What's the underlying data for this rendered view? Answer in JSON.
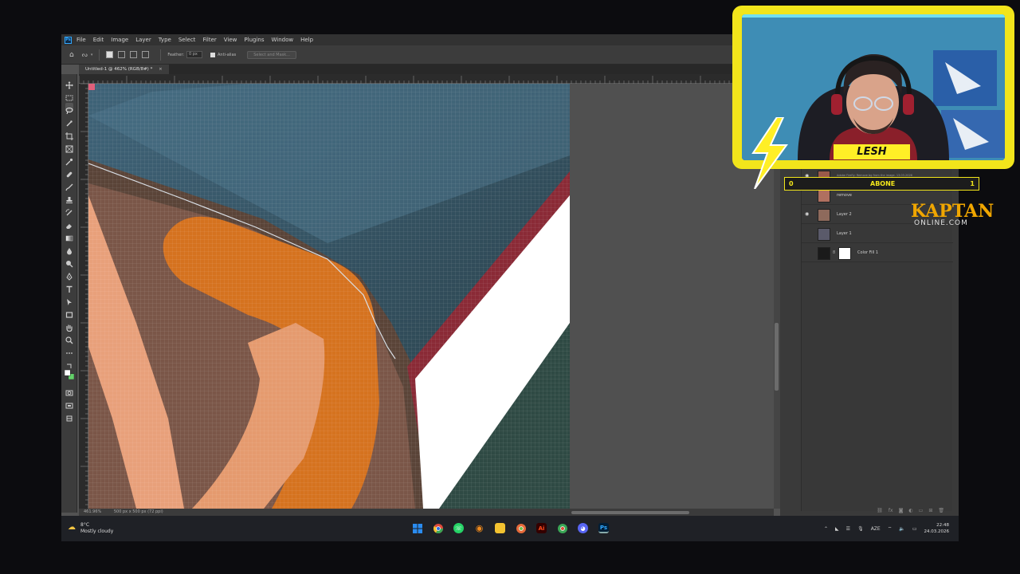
{
  "app": {
    "menu": [
      "File",
      "Edit",
      "Image",
      "Layer",
      "Type",
      "Select",
      "Filter",
      "View",
      "Plugins",
      "Window",
      "Help"
    ],
    "options_bar": {
      "feather_label": "Feather:",
      "feather_value": "0 px",
      "antialias_label": "Anti-alias",
      "select_mask_label": "Select and Mask..."
    },
    "document_tab": {
      "title": "Untitled-1 @ 462% (RGB/8#) *",
      "close": "×"
    },
    "status_bar": {
      "zoom": "461.96%",
      "doc_size": "500 px x 500 px (72 ppi)"
    },
    "layers": [
      {
        "name": "Adobe Firefly: Remove bg from the image. 13.03.2026",
        "visible": true
      },
      {
        "name": "remove",
        "visible": false
      },
      {
        "name": "Layer 2",
        "visible": true
      },
      {
        "name": "Layer 1",
        "visible": false
      },
      {
        "name": "Color Fill 1",
        "visible": false,
        "has_mask": true
      }
    ],
    "layers_footer_icons": [
      "link-icon",
      "fx-icon",
      "mask-icon",
      "adjustment-icon",
      "group-icon",
      "new-layer-icon",
      "trash-icon"
    ]
  },
  "taskbar": {
    "weather": {
      "temp": "8°C",
      "condition": "Mostly cloudy"
    },
    "language": "AZE",
    "time": "22:48",
    "date": "24.03.2026",
    "apps": [
      {
        "name": "windows-start-icon",
        "color": "#2a8cf0"
      },
      {
        "name": "chrome-icon",
        "color": "#e04b3a"
      },
      {
        "name": "whatsapp-icon",
        "color": "#25d366"
      },
      {
        "name": "blender-icon",
        "color": "#f08a1c"
      },
      {
        "name": "file-explorer-icon",
        "color": "#f2c230"
      },
      {
        "name": "chrome-alt-icon",
        "color": "#4caf50"
      },
      {
        "name": "illustrator-icon",
        "label": "Ai",
        "color": "#330000"
      },
      {
        "name": "chrome-dev-icon",
        "color": "#3aa655"
      },
      {
        "name": "discord-icon",
        "color": "#5865f2"
      },
      {
        "name": "photoshop-icon",
        "label": "Ps",
        "color": "#001e36"
      }
    ]
  },
  "overlay": {
    "streamer_name": "LESH",
    "subscriber_goal": {
      "current": "0",
      "label": "ABONE",
      "target": "1"
    },
    "brand_main": "KAPTAN",
    "brand_sub": "ONLINE.COM",
    "colors": {
      "accent": "#f2e51b",
      "brand": "#f0a600"
    }
  }
}
